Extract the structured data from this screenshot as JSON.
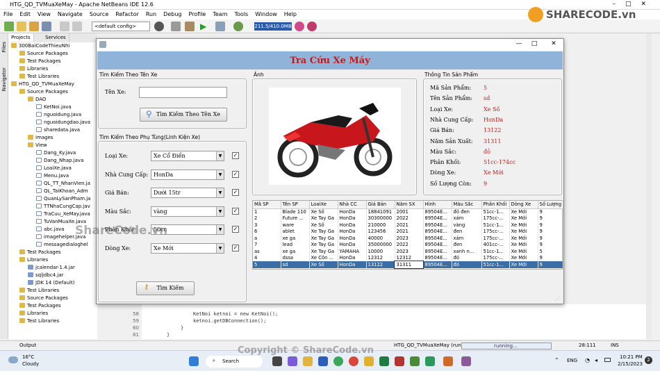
{
  "ide": {
    "title": "HTG_QD_TVMuaXeMay - Apache NetBeans IDE 12.6",
    "menu": [
      "File",
      "Edit",
      "View",
      "Navigate",
      "Source",
      "Refactor",
      "Run",
      "Debug",
      "Profile",
      "Team",
      "Tools",
      "Window",
      "Help"
    ],
    "config": "<default config>",
    "memory": "211.5/410.0MB",
    "side_tabs": [
      "Files",
      "Navigator"
    ],
    "panel_tabs": [
      "Projects",
      "Services"
    ],
    "tree": [
      {
        "label": "300BaiCodeThieuNhi",
        "indent": 0,
        "icon": "project"
      },
      {
        "label": "Source Packages",
        "indent": 1,
        "icon": "folder"
      },
      {
        "label": "Test Packages",
        "indent": 1,
        "icon": "folder"
      },
      {
        "label": "Libraries",
        "indent": 1,
        "icon": "folder"
      },
      {
        "label": "Test Libraries",
        "indent": 1,
        "icon": "folder"
      },
      {
        "label": "HTG_QD_TVMuaXeMay",
        "indent": 0,
        "icon": "project"
      },
      {
        "label": "Source Packages",
        "indent": 1,
        "icon": "folder"
      },
      {
        "label": "DAO",
        "indent": 2,
        "icon": "folder"
      },
      {
        "label": "KetNoi.java",
        "indent": 3,
        "icon": "file"
      },
      {
        "label": "nguoidung.java",
        "indent": 3,
        "icon": "file"
      },
      {
        "label": "nguoidungdao.java",
        "indent": 3,
        "icon": "file"
      },
      {
        "label": "sharedata.java",
        "indent": 3,
        "icon": "file"
      },
      {
        "label": "Images",
        "indent": 2,
        "icon": "folder"
      },
      {
        "label": "View",
        "indent": 2,
        "icon": "folder"
      },
      {
        "label": "Dang_Ky.java",
        "indent": 3,
        "icon": "file"
      },
      {
        "label": "Dang_Nhap.java",
        "indent": 3,
        "icon": "file"
      },
      {
        "label": "LoaiXe.java",
        "indent": 3,
        "icon": "file"
      },
      {
        "label": "Menu.java",
        "indent": 3,
        "icon": "file"
      },
      {
        "label": "QL_TT_NhanVien.ja",
        "indent": 3,
        "icon": "file"
      },
      {
        "label": "QL_TaiKhoan_Adm",
        "indent": 3,
        "icon": "file"
      },
      {
        "label": "QuanLySanPham.ja",
        "indent": 3,
        "icon": "file"
      },
      {
        "label": "TTNhaCungCap.jav",
        "indent": 3,
        "icon": "file"
      },
      {
        "label": "TraCuu_XeMay.java",
        "indent": 3,
        "icon": "file"
      },
      {
        "label": "TuVanMuaXe.java",
        "indent": 3,
        "icon": "file"
      },
      {
        "label": "abc.java",
        "indent": 3,
        "icon": "file"
      },
      {
        "label": "imagehelper.java",
        "indent": 3,
        "icon": "file"
      },
      {
        "label": "messagedialoghel",
        "indent": 3,
        "icon": "file"
      },
      {
        "label": "Test Packages",
        "indent": 1,
        "icon": "folder"
      },
      {
        "label": "Libraries",
        "indent": 1,
        "icon": "folder"
      },
      {
        "label": "jcalendar-1.4.jar",
        "indent": 2,
        "icon": "lib"
      },
      {
        "label": "sqljdbc4.jar",
        "indent": 2,
        "icon": "lib"
      },
      {
        "label": "JDK 14 (Default)",
        "indent": 2,
        "icon": "lib"
      },
      {
        "label": "Test Libraries",
        "indent": 1,
        "icon": "folder"
      },
      {
        "label": "Source Packages",
        "indent": 1,
        "icon": "folder"
      },
      {
        "label": "Test Packages",
        "indent": 1,
        "icon": "folder"
      },
      {
        "label": "Libraries",
        "indent": 1,
        "icon": "folder"
      },
      {
        "label": "Test Libraries",
        "indent": 1,
        "icon": "folder"
      }
    ],
    "code_lines": [
      {
        "num": "58",
        "text": "KetNoi ketnoi = new KetNoi();"
      },
      {
        "num": "59",
        "text": "ketnoi.getDBConnection();"
      },
      {
        "num": "60",
        "text": "}"
      },
      {
        "num": "61",
        "text": "}"
      }
    ],
    "status": {
      "output_tab": "Output",
      "run_label": "HTG_QD_TVMuaXeMay (run)",
      "progress": "running...",
      "position": "28:111",
      "mode": "INS"
    }
  },
  "watermark": {
    "logo": "SHARECODE.vn",
    "center": "ShareCode.vn",
    "footer": "Copyright © ShareCode.vn"
  },
  "dialog": {
    "title": "Tra Cứu Xe Máy",
    "search_name": {
      "group_label": "Tìm Kiếm Theo Tên Xe",
      "field_label": "Tên Xe:",
      "value": "",
      "button": "Tìm Kiếm Theo Tên Xe"
    },
    "search_parts": {
      "group_label": "Tìm Kiếm Theo Phụ Tùng(Linh Kiện Xe)",
      "filters": [
        {
          "label": "Loại Xe:",
          "value": "Xe Cổ Điển",
          "checked": true
        },
        {
          "label": "Nhà Cung Cấp:",
          "value": "HonDa",
          "checked": true
        },
        {
          "label": "Giá Bán:",
          "value": "Dưới 15tr",
          "checked": true
        },
        {
          "label": "Màu Sắc:",
          "value": "vàng",
          "checked": true
        },
        {
          "label": "Phân Khối:",
          "value": "50cc",
          "checked": true
        },
        {
          "label": "Dòng Xe:",
          "value": "Xe Mới",
          "checked": true
        }
      ],
      "button": "Tìm Kiếm"
    },
    "image_label": "Ảnh",
    "info": {
      "group_label": "Thông Tin Sản Phẩm",
      "rows": [
        {
          "label": "Mã Sản Phẩm:",
          "value": "5"
        },
        {
          "label": "Tên Sản Phẩm:",
          "value": "sd"
        },
        {
          "label": "Loại Xe:",
          "value": "Xe Số"
        },
        {
          "label": "Nhà Cung Cấp:",
          "value": "HonDa"
        },
        {
          "label": "Giá Bán:",
          "value": "13122"
        },
        {
          "label": "Năm Sản Xuất:",
          "value": "31311"
        },
        {
          "label": "Màu Sắc:",
          "value": "đỏ"
        },
        {
          "label": "Phân Khối:",
          "value": "51cc-174cc"
        },
        {
          "label": "Dòng Xe:",
          "value": "Xe Mới"
        },
        {
          "label": "Số Lượng Còn:",
          "value": "9"
        }
      ]
    },
    "table": {
      "columns": [
        "Mã SP",
        "Tên SP",
        "LoaiXe",
        "Nhà CC",
        "Giá Bán",
        "Năm SX",
        "Hình",
        "Màu Sắc",
        "Phân Khối",
        "Dòng Xe",
        "Số Lượng"
      ],
      "rows": [
        [
          "1",
          "Blade 110",
          "Xe Số",
          "HonDa",
          "18841091",
          "2001",
          "89504E...",
          "đỏ đen",
          "51cc-1...",
          "Xe Mới",
          "9"
        ],
        [
          "2",
          "Future ...",
          "Xe Tay Ga",
          "HonDa",
          "30300000",
          "2022",
          "89504E...",
          "xám",
          "175cc-...",
          "Xe Mới",
          "9"
        ],
        [
          "3",
          "ware",
          "Xe Số",
          "HonDa",
          "210000",
          "2021",
          "89504E...",
          "vàng",
          "51cc-1...",
          "Xe Mới",
          "9"
        ],
        [
          "6",
          "ablet",
          "Xe Tay Ga",
          "HonDa",
          "123456",
          "2021",
          "89504E...",
          "đen",
          "175cc-...",
          "Xe Mới",
          "9"
        ],
        [
          "a",
          "xe ga",
          "Xe Tay Ga",
          "HonDa",
          "40000",
          "2023",
          "89504E...",
          "xám",
          "175cc-...",
          "Xe Mới",
          "9"
        ],
        [
          "7",
          "lead",
          "Xe Tay Ga",
          "HonDa",
          "35000000",
          "2022",
          "89504E...",
          "đen",
          "401cc-...",
          "Xe Mới",
          "9"
        ],
        [
          "as",
          "xe ga",
          "Xe Tay Ga",
          "YAMAHA",
          "10000",
          "2023",
          "89504E...",
          "xanh n...",
          "51cc-1...",
          "Xe Mới",
          "5"
        ],
        [
          "4",
          "dssa",
          "Xe Côn ...",
          "HonDa",
          "12312",
          "12312",
          "89504E...",
          "đỏ",
          "175cc-...",
          "Xe Mới",
          "9"
        ],
        [
          "5",
          "sd",
          "Xe Số",
          "HonDa",
          "13122",
          "31311",
          "89504E...",
          "đỏ",
          "51cc-1...",
          "Xe Mới",
          "9"
        ]
      ],
      "selected_row": 8
    }
  },
  "taskbar": {
    "weather_temp": "16°C",
    "weather_desc": "Cloudy",
    "search": "Search",
    "lang": "ENG",
    "time": "10:21 PM",
    "date": "2/15/2023",
    "badge": "2"
  },
  "colors": {
    "banner": "#8fb3d9",
    "title_red": "#c21a1a",
    "selected": "#3a6ea5",
    "memory": "#2b5aa6"
  }
}
